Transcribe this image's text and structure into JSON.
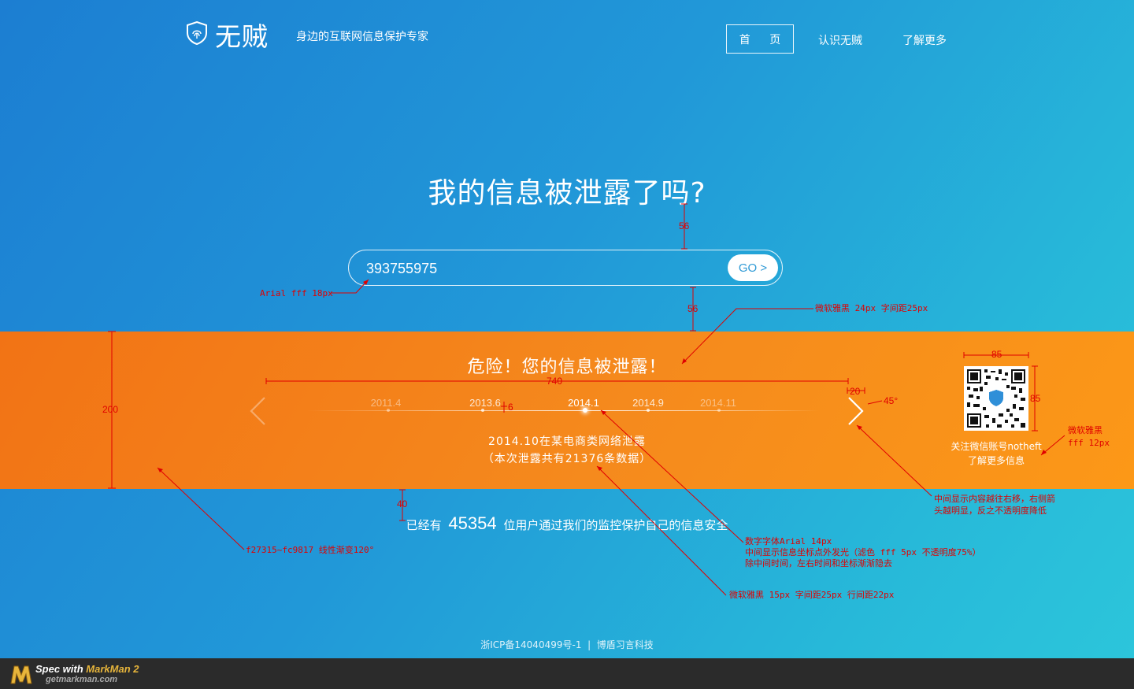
{
  "header": {
    "logo_text": "无贼",
    "tagline": "身边的互联网信息保护专家",
    "nav": [
      {
        "label": "首  页"
      },
      {
        "label": "认识无贼"
      },
      {
        "label": "了解更多"
      }
    ]
  },
  "hero": {
    "title": "我的信息被泄露了吗?",
    "search_value": "393755975",
    "go_label": "GO >"
  },
  "alert": {
    "title": "危险！您的信息被泄露！",
    "timeline": [
      "2011.4",
      "2013.6",
      "2014.1",
      "2014.9",
      "2014.11"
    ],
    "active_index": 2,
    "event_line1": "2014.10在某电商类网络泄露",
    "event_line2": "（本次泄露共有21376条数据）",
    "qr_caption_line1": "关注微信账号notheft",
    "qr_caption_line2": "了解更多信息"
  },
  "stats": {
    "prefix": "已经有",
    "count": "45354",
    "suffix": "位用户通过我们的监控保护自己的信息安全"
  },
  "footer": {
    "text": "浙ICP备14040499号-1  |  博盾习言科技"
  },
  "markman": {
    "spec_with": "Spec with ",
    "brand": "MarkMan 2",
    "site": "getmarkman.com"
  },
  "annotations": {
    "dim_56_top": "56",
    "dim_56_bottom": "56",
    "dim_740": "740",
    "dim_200": "200",
    "dim_6": "6",
    "dim_20": "20",
    "dim_45deg": "45°",
    "dim_85_w": "85",
    "dim_85_h": "85",
    "dim_40": "40",
    "input_font": "Arial fff 18px",
    "title_font": "微软雅黑 24px 字间距25px",
    "qr_font_1": "微软雅黑",
    "qr_font_2": "fff 12px",
    "arrow_note_1": "中间显示内容越往右移，右侧箭",
    "arrow_note_2": "头越明显，反之不透明度降低",
    "gradient_note": "f27315~fc9817 线性渐变120°",
    "timeline_note_1": "数字字体Arial 14px",
    "timeline_note_2": "中间显示信息坐标点外发光（滤色 fff 5px 不透明度75%）",
    "timeline_note_3": "除中间时间，左右时间和坐标渐渐隐去",
    "event_note": "微软雅黑 15px 字间距25px 行间距22px"
  },
  "colors": {
    "band_start": "#f27315",
    "band_end": "#fc9817",
    "annotation": "#e00000"
  }
}
